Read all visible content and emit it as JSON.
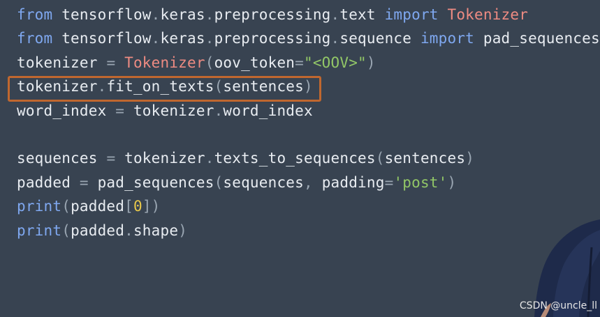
{
  "code": {
    "lines": [
      [
        {
          "text": "from",
          "cls": "kw"
        },
        {
          "text": " tensorflow",
          "cls": ""
        },
        {
          "text": ".",
          "cls": "op"
        },
        {
          "text": "keras",
          "cls": ""
        },
        {
          "text": ".",
          "cls": "op"
        },
        {
          "text": "preprocessing",
          "cls": ""
        },
        {
          "text": ".",
          "cls": "op"
        },
        {
          "text": "text ",
          "cls": ""
        },
        {
          "text": "import",
          "cls": "kw"
        },
        {
          "text": " Tokenizer",
          "cls": "cls"
        }
      ],
      [
        {
          "text": "from",
          "cls": "kw"
        },
        {
          "text": " tensorflow",
          "cls": ""
        },
        {
          "text": ".",
          "cls": "op"
        },
        {
          "text": "keras",
          "cls": ""
        },
        {
          "text": ".",
          "cls": "op"
        },
        {
          "text": "preprocessing",
          "cls": ""
        },
        {
          "text": ".",
          "cls": "op"
        },
        {
          "text": "sequence ",
          "cls": ""
        },
        {
          "text": "import",
          "cls": "kw"
        },
        {
          "text": " pad_sequences",
          "cls": ""
        }
      ],
      [
        {
          "text": "tokenizer ",
          "cls": ""
        },
        {
          "text": "=",
          "cls": "op"
        },
        {
          "text": " Tokenizer",
          "cls": "cls"
        },
        {
          "text": "(",
          "cls": "op"
        },
        {
          "text": "oov_token",
          "cls": ""
        },
        {
          "text": "=",
          "cls": "op"
        },
        {
          "text": "\"<OOV>\"",
          "cls": "str"
        },
        {
          "text": ")",
          "cls": "op"
        }
      ],
      [
        {
          "text": "tokenizer",
          "cls": ""
        },
        {
          "text": ".",
          "cls": "op"
        },
        {
          "text": "fit_on_texts",
          "cls": ""
        },
        {
          "text": "(",
          "cls": "op"
        },
        {
          "text": "sentences",
          "cls": ""
        },
        {
          "text": ")",
          "cls": "op"
        }
      ],
      [
        {
          "text": "word_index ",
          "cls": ""
        },
        {
          "text": "=",
          "cls": "op"
        },
        {
          "text": " tokenizer",
          "cls": ""
        },
        {
          "text": ".",
          "cls": "op"
        },
        {
          "text": "word_index",
          "cls": ""
        }
      ],
      [],
      [
        {
          "text": "sequences ",
          "cls": ""
        },
        {
          "text": "=",
          "cls": "op"
        },
        {
          "text": " tokenizer",
          "cls": ""
        },
        {
          "text": ".",
          "cls": "op"
        },
        {
          "text": "texts_to_sequences",
          "cls": ""
        },
        {
          "text": "(",
          "cls": "op"
        },
        {
          "text": "sentences",
          "cls": ""
        },
        {
          "text": ")",
          "cls": "op"
        }
      ],
      [
        {
          "text": "padded ",
          "cls": ""
        },
        {
          "text": "=",
          "cls": "op"
        },
        {
          "text": " pad_sequences",
          "cls": ""
        },
        {
          "text": "(",
          "cls": "op"
        },
        {
          "text": "sequences",
          "cls": ""
        },
        {
          "text": ", ",
          "cls": "op"
        },
        {
          "text": "padding",
          "cls": ""
        },
        {
          "text": "=",
          "cls": "op"
        },
        {
          "text": "'post'",
          "cls": "str"
        },
        {
          "text": ")",
          "cls": "op"
        }
      ],
      [
        {
          "text": "print",
          "cls": "fn"
        },
        {
          "text": "(",
          "cls": "op"
        },
        {
          "text": "padded",
          "cls": ""
        },
        {
          "text": "[",
          "cls": "op"
        },
        {
          "text": "0",
          "cls": "num"
        },
        {
          "text": "])",
          "cls": "op"
        }
      ],
      [
        {
          "text": "print",
          "cls": "fn"
        },
        {
          "text": "(",
          "cls": "op"
        },
        {
          "text": "padded",
          "cls": ""
        },
        {
          "text": ".",
          "cls": "op"
        },
        {
          "text": "shape",
          "cls": ""
        },
        {
          "text": ")",
          "cls": "op"
        }
      ]
    ],
    "highlighted_line": 3
  },
  "colors": {
    "background": "#384351",
    "highlight_border": "#c0672f",
    "keyword": "#7fa8f0",
    "class_name": "#ee8b82",
    "string": "#92c767",
    "number": "#e8c84a"
  },
  "presenter": {
    "icon": "person-silhouette"
  },
  "watermark": {
    "text": "CSDN @uncle_ll"
  }
}
